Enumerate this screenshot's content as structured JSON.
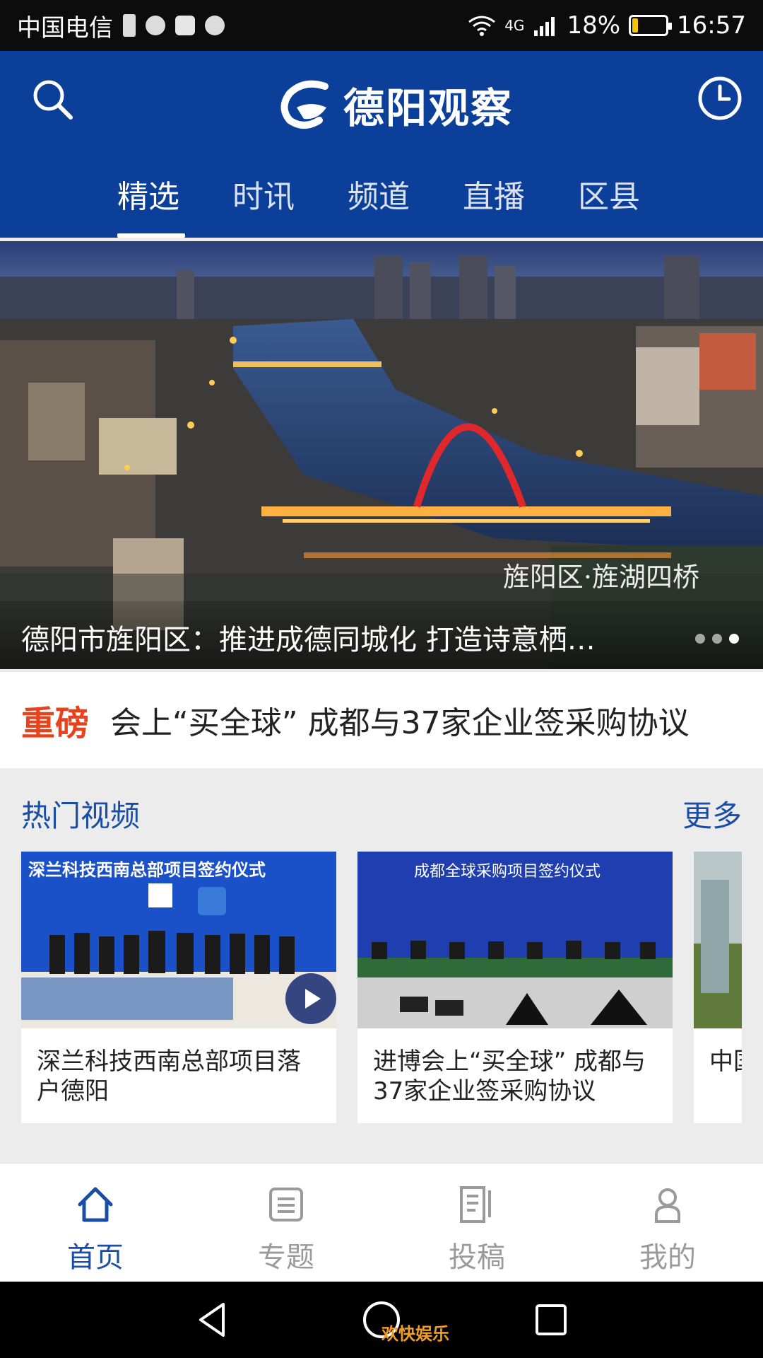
{
  "status_bar": {
    "carrier": "中国电信",
    "network": "4G",
    "battery": "18%",
    "battery_level": 0.18,
    "time": "16:57"
  },
  "header": {
    "logo_text": "德阳观察",
    "icons": [
      "search-icon",
      "clock-icon"
    ],
    "tabs": [
      {
        "label": "精选",
        "active": true
      },
      {
        "label": "时讯",
        "active": false
      },
      {
        "label": "频道",
        "active": false
      },
      {
        "label": "直播",
        "active": false
      },
      {
        "label": "区县",
        "active": false
      }
    ]
  },
  "banner": {
    "image_tag": "旌阳区·旌湖四桥",
    "caption": "德阳市旌阳区：推进成德同城化 打造诗意栖…"
  },
  "headline": {
    "badge": "重磅",
    "text": "会上“买全球” 成都与37家企业签采购协议"
  },
  "hot_videos": {
    "title": "热门视频",
    "more": "更多",
    "items": [
      {
        "title": "深兰科技西南总部项目落户德阳",
        "thumb_text": "深兰科技西南总部项目签约仪式"
      },
      {
        "title": "进博会上“买全球” 成都与37家企业签采购协议",
        "thumb_text": "成都全球采购项目签约仪式"
      },
      {
        "title": "中国脚步",
        "thumb_text": ""
      }
    ]
  },
  "bottom_nav": [
    {
      "label": "首页",
      "icon": "home-icon",
      "active": true
    },
    {
      "label": "专题",
      "icon": "topic-icon",
      "active": false
    },
    {
      "label": "投稿",
      "icon": "submit-icon",
      "active": false
    },
    {
      "label": "我的",
      "icon": "profile-icon",
      "active": false
    }
  ],
  "system_nav": {
    "watermark": "欢快娱乐"
  },
  "colors": {
    "brand": "#0c3f9a",
    "accent_red": "#e8421d",
    "link_blue": "#1a4da4"
  }
}
